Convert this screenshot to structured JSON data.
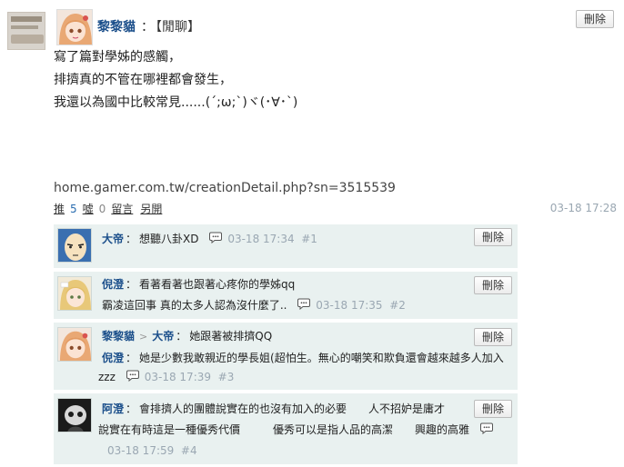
{
  "post": {
    "author": "黎黎貓",
    "colon": "：",
    "title": "【閒聊】",
    "lines": [
      "寫了篇對學姊的感觸，",
      "排擠真的不管在哪裡都會發生，",
      "我還以為國中比較常見......(´;ω;`)ヾ(･∀･`)"
    ],
    "link": "home.gamer.com.tw/creationDetail.php?sn=3515539",
    "delete_label": "刪除",
    "time": "03-18 17:28",
    "stats": {
      "push_label": "推",
      "push_count": "5",
      "boo_label": "噓",
      "boo_count": "0",
      "reply_label": "留言",
      "more_label": "另開"
    }
  },
  "comments": [
    {
      "author": "大帝",
      "text": "想聽八卦XD",
      "time": "03-18 17:34",
      "floor": "#1",
      "delete_label": "刪除"
    },
    {
      "author": "倪澄",
      "text": "看著看著也跟著心疼你的學姊qq",
      "text2": "霸凌這回事 真的太多人認為沒什麼了..",
      "time": "03-18 17:35",
      "floor": "#2",
      "delete_label": "刪除"
    },
    {
      "author": "黎黎貓",
      "reply_arrow": ">",
      "reply_to": "大帝",
      "text": "她跟著被排擠QQ",
      "author2": "倪澄",
      "text2": "她是少數我敢親近的學長姐(超怕生。無心的嘲笑和欺負還會越來越多人加入",
      "text3": "zzz",
      "time": "03-18 17:39",
      "floor": "#3",
      "delete_label": "刪除"
    },
    {
      "author": "阿澄",
      "text": "會排擠人的團體說實在的也沒有加入的必要　　人不招妒是庸才",
      "text2": "說實在有時這是一種優秀代價　　　優秀可以是指人品的高潔　　興趣的高雅",
      "time": "03-18 17:59",
      "floor": "#4",
      "delete_label": "刪除"
    }
  ],
  "icons": {
    "speech": "speech-bubble-icon"
  },
  "colors": {
    "link": "#1a4e8a",
    "meta": "#9aa7b2",
    "comment_bg": "#e9f1f0"
  }
}
